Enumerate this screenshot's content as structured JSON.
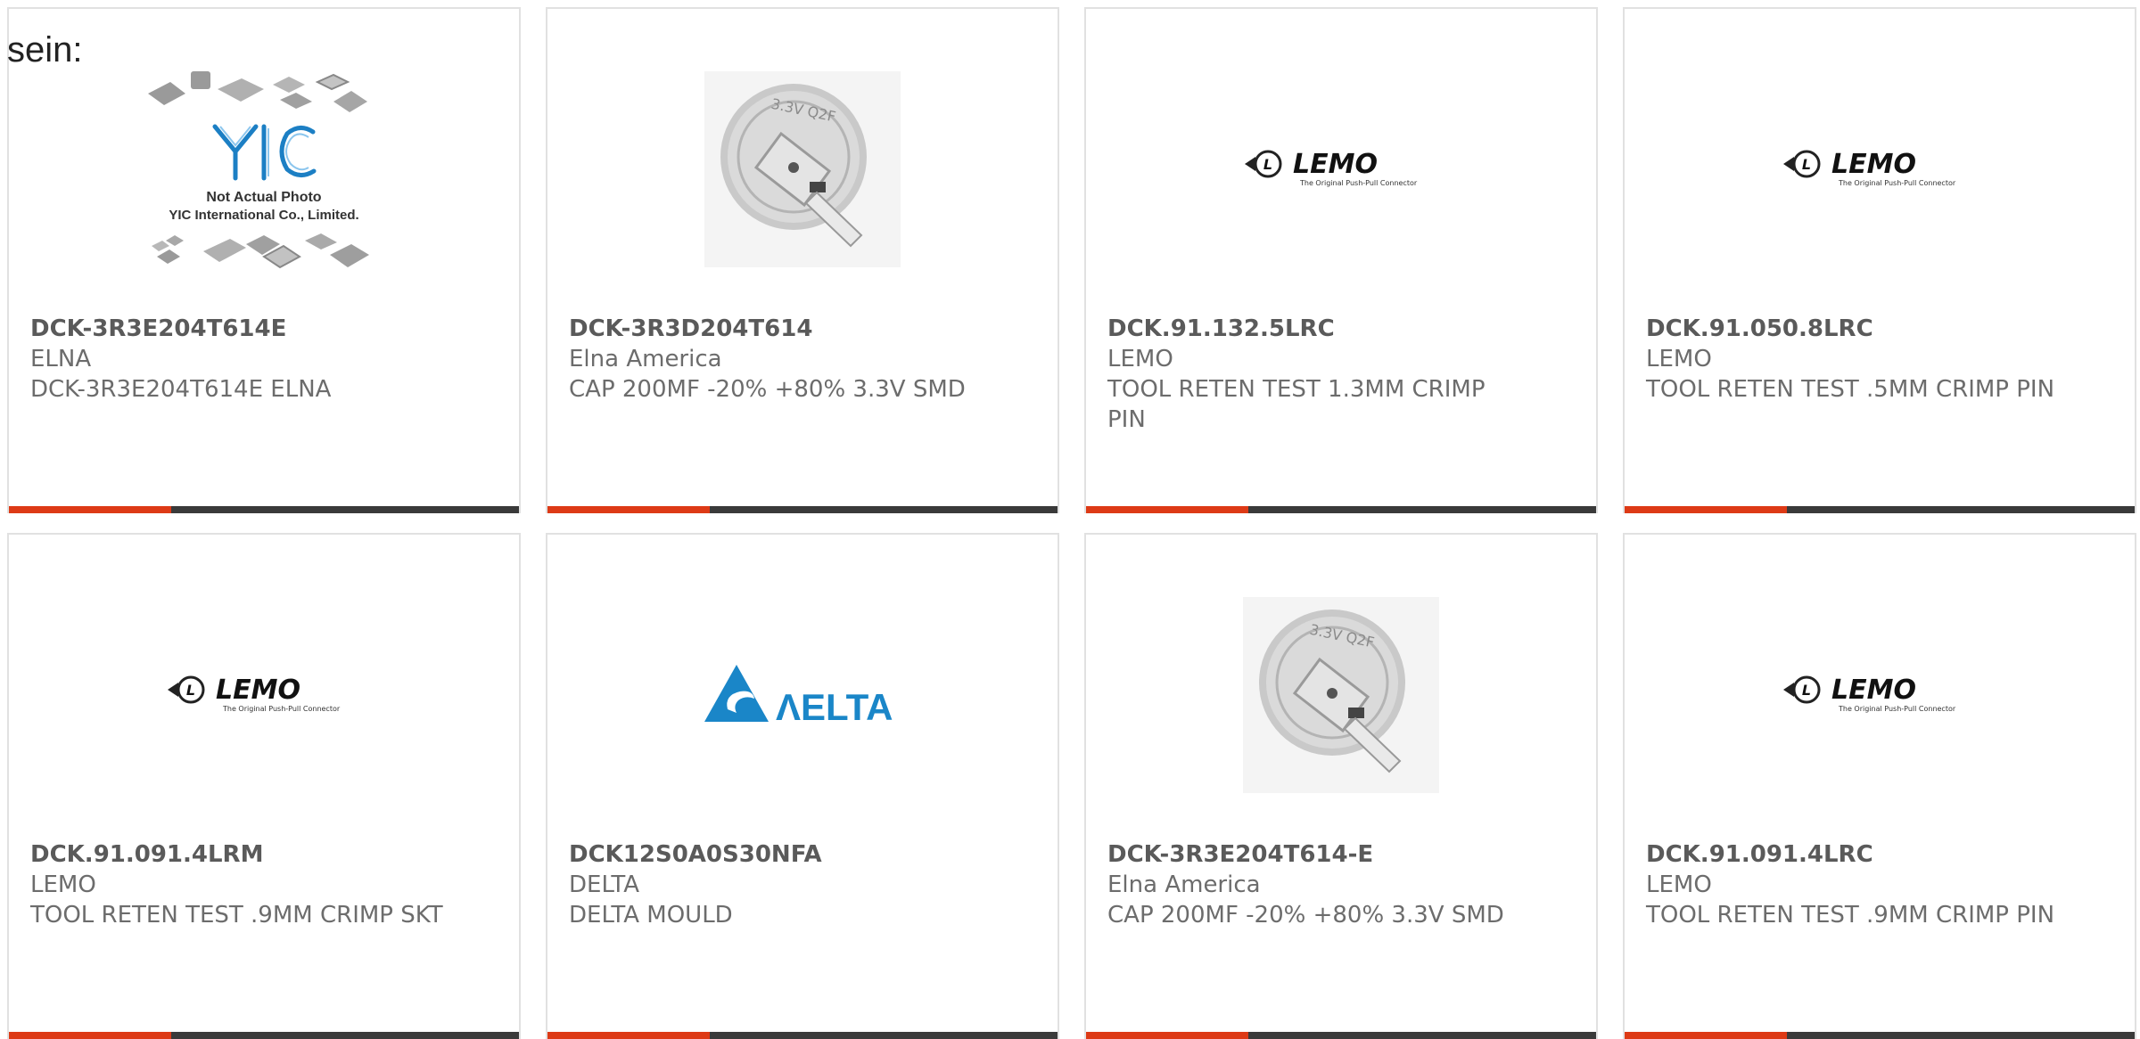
{
  "intro_text": "sein:",
  "colors": {
    "accent": "#dd3a16",
    "bar_dark": "#3a3a3a",
    "card_border": "#e1e1e1",
    "text": "#6c6c6c"
  },
  "products": [
    {
      "part_number": "DCK-3R3E204T614E",
      "manufacturer": "ELNA",
      "description": "DCK-3R3E204T614E ELNA",
      "image": "yic-placeholder",
      "image_text": {
        "line1": "Not Actual Photo",
        "line2": "YIC International Co., Limited.",
        "logo": "YIC"
      }
    },
    {
      "part_number": "DCK-3R3D204T614",
      "manufacturer": "Elna America",
      "description": "CAP 200MF -20% +80% 3.3V SMD",
      "image": "coin-cell"
    },
    {
      "part_number": "DCK.91.132.5LRC",
      "manufacturer": "LEMO",
      "description": "TOOL RETEN TEST 1.3MM CRIMP PIN",
      "image": "lemo-logo",
      "image_text": {
        "brand": "LEMO",
        "tagline": "The Original Push-Pull Connector"
      }
    },
    {
      "part_number": "DCK.91.050.8LRC",
      "manufacturer": "LEMO",
      "description": "TOOL RETEN TEST .5MM CRIMP PIN",
      "image": "lemo-logo",
      "image_text": {
        "brand": "LEMO",
        "tagline": "The Original Push-Pull Connector"
      }
    },
    {
      "part_number": "DCK.91.091.4LRM",
      "manufacturer": "LEMO",
      "description": "TOOL RETEN TEST .9MM CRIMP SKT",
      "image": "lemo-logo",
      "image_text": {
        "brand": "LEMO",
        "tagline": "The Original Push-Pull Connector"
      }
    },
    {
      "part_number": "DCK12S0A0S30NFA",
      "manufacturer": "DELTA",
      "description": "DELTA MOULD",
      "image": "delta-logo",
      "image_text": {
        "brand": "ΛELTA"
      }
    },
    {
      "part_number": "DCK-3R3E204T614-E",
      "manufacturer": "Elna America",
      "description": "CAP 200MF -20% +80% 3.3V SMD",
      "image": "coin-cell"
    },
    {
      "part_number": "DCK.91.091.4LRC",
      "manufacturer": "LEMO",
      "description": "TOOL RETEN TEST .9MM CRIMP PIN",
      "image": "lemo-logo",
      "image_text": {
        "brand": "LEMO",
        "tagline": "The Original Push-Pull Connector"
      }
    }
  ]
}
